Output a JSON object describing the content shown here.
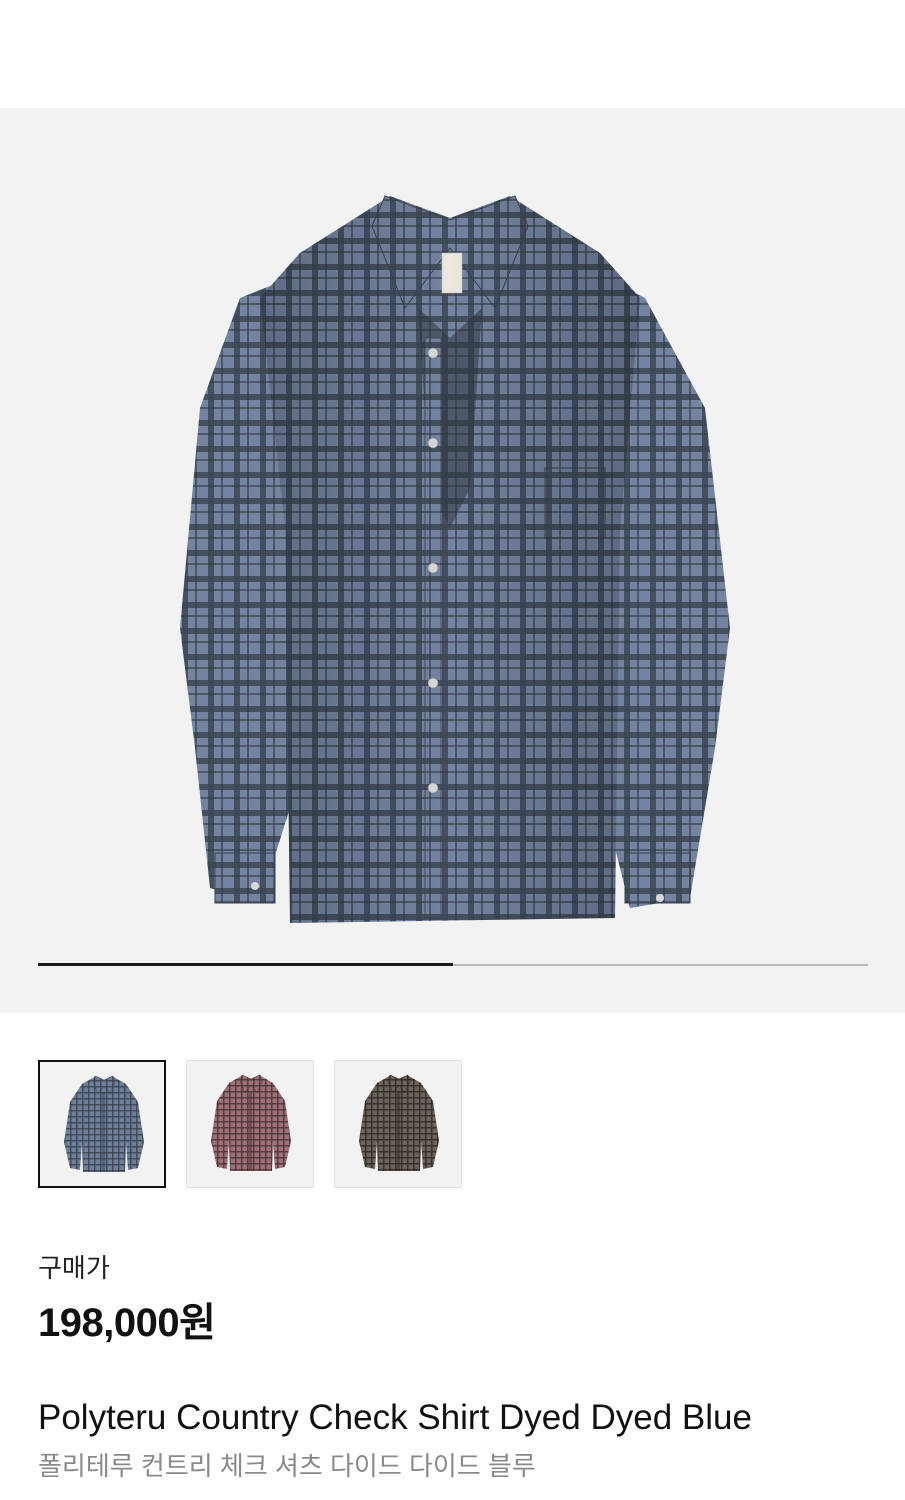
{
  "gallery": {
    "main_image": "blue-check-shirt",
    "progress": 0.5
  },
  "variants": [
    {
      "name": "Dyed Blue",
      "color": "#6f7f98",
      "check": "#3b4452",
      "selected": true
    },
    {
      "name": "Dyed Red",
      "color": "#9e6f74",
      "check": "#4a3338",
      "selected": false
    },
    {
      "name": "Dyed Brown",
      "color": "#6b6259",
      "check": "#2f2a25",
      "selected": false
    }
  ],
  "price": {
    "label": "구매가",
    "value": "198,000원"
  },
  "product": {
    "name_en": "Polyteru Country Check Shirt Dyed Dyed Blue",
    "name_ko": "폴리테루 컨트리 체크 셔츠 다이드 다이드 블루"
  },
  "colors": {
    "background": "#ffffff",
    "hero_background": "#f2f2f2",
    "text_primary": "#111111",
    "text_secondary": "#8a8a8a"
  }
}
